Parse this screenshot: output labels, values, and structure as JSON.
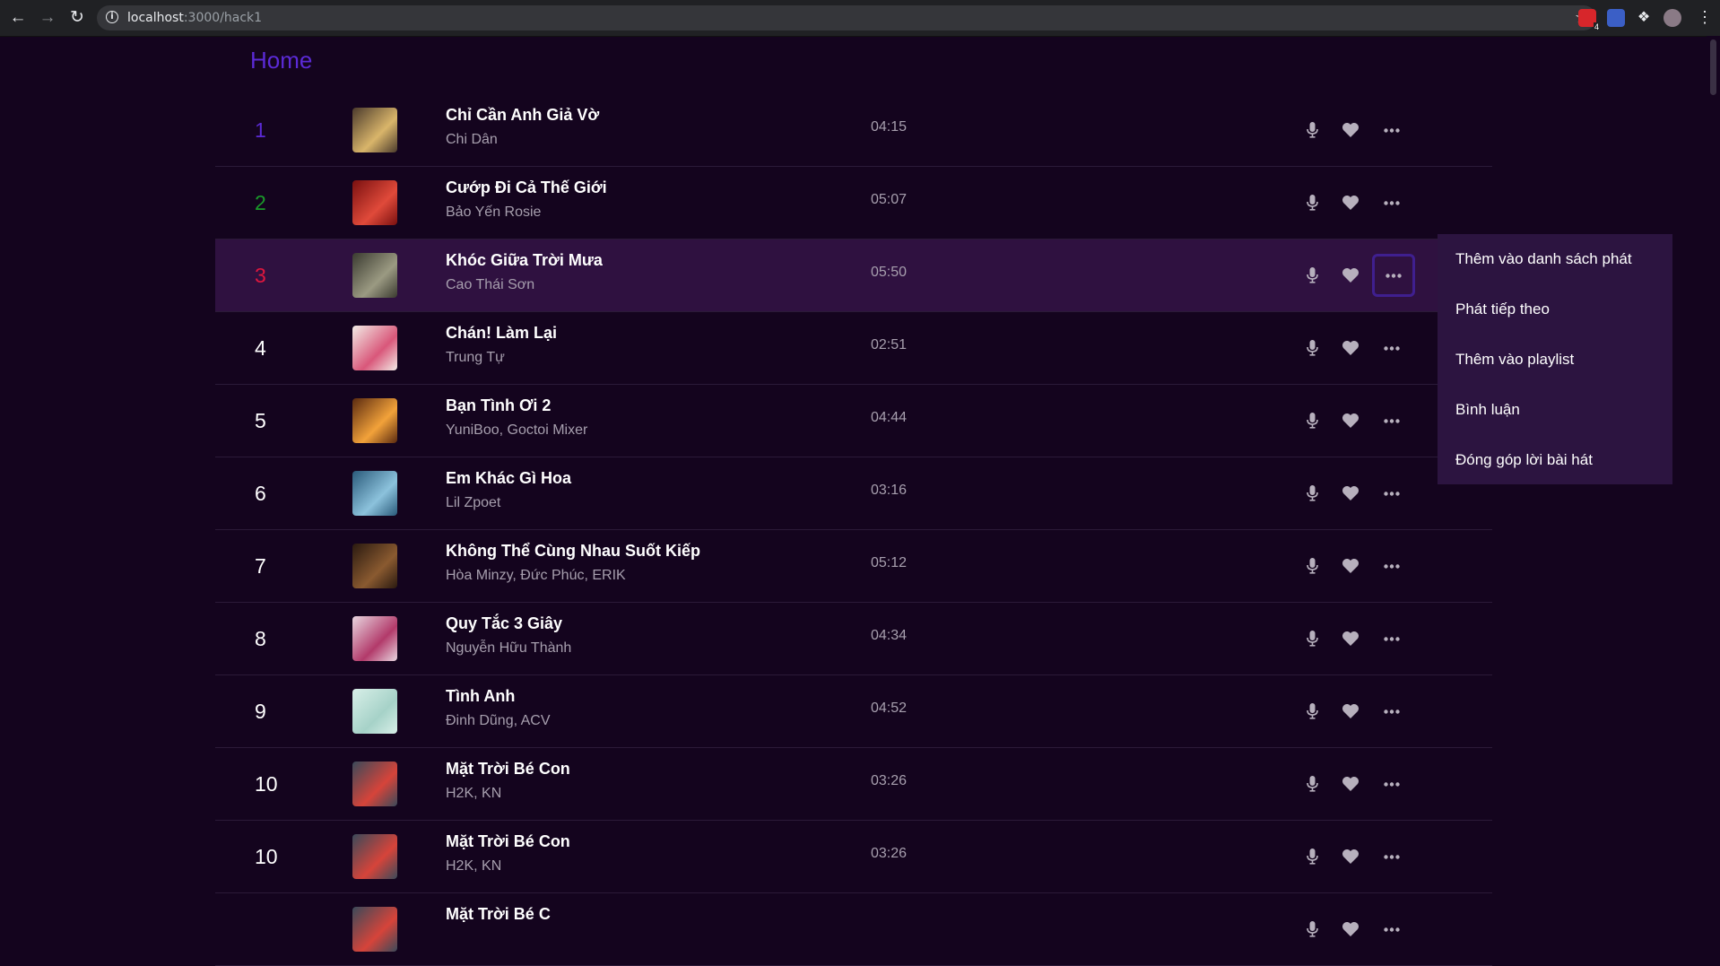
{
  "browser": {
    "url_host": "localhost",
    "url_path": ":3000/hack1",
    "ext_badge": "4"
  },
  "home_label": "Home",
  "colors": {
    "rank1": "#5b2ad6",
    "rank2": "#1a9a2a",
    "rank3": "#e0173e",
    "rank_default": "#ffffff",
    "active_row": "#2f1140",
    "dropdown_bg": "#2c1440"
  },
  "songs": [
    {
      "rank": "1",
      "title": "Chỉ Cần Anh Giả Vờ",
      "artist": "Chi Dân",
      "duration": "04:15",
      "thumb": [
        "#4a3a2c",
        "#d9b56a"
      ]
    },
    {
      "rank": "2",
      "title": "Cướp Đi Cả Thế Giới",
      "artist": "Bảo Yến Rosie",
      "duration": "05:07",
      "thumb": [
        "#7a1010",
        "#e04a3a"
      ]
    },
    {
      "rank": "3",
      "title": "Khóc Giữa Trời Mưa",
      "artist": "Cao Thái Sơn",
      "duration": "05:50",
      "thumb": [
        "#3a3a30",
        "#9b9a82"
      ]
    },
    {
      "rank": "4",
      "title": "Chán! Làm Lại",
      "artist": "Trung Tự",
      "duration": "02:51",
      "thumb": [
        "#f2ece6",
        "#d9577a"
      ]
    },
    {
      "rank": "5",
      "title": "Bạn Tình Ơi 2",
      "artist": "YuniBoo, Goctoi Mixer",
      "duration": "04:44",
      "thumb": [
        "#5a2a10",
        "#f2a23a"
      ]
    },
    {
      "rank": "6",
      "title": "Em Khác Gì Hoa",
      "artist": "Lil Zpoet",
      "duration": "03:16",
      "thumb": [
        "#2a5a7a",
        "#8cc2dc"
      ]
    },
    {
      "rank": "7",
      "title": "Không Thể Cùng Nhau Suốt Kiếp",
      "artist": "Hòa Minzy, Đức Phúc, ERIK",
      "duration": "05:12",
      "thumb": [
        "#2a1a10",
        "#8a5a30"
      ]
    },
    {
      "rank": "8",
      "title": "Quy Tắc 3 Giây",
      "artist": "Nguyễn Hữu Thành",
      "duration": "04:34",
      "thumb": [
        "#e8d6e0",
        "#b23a6a"
      ]
    },
    {
      "rank": "9",
      "title": "Tình Anh",
      "artist": "Đinh Dũng, ACV",
      "duration": "04:52",
      "thumb": [
        "#d8efe8",
        "#a6d2c8"
      ]
    },
    {
      "rank": "10",
      "title": "Mặt Trời Bé Con",
      "artist": "H2K, KN",
      "duration": "03:26",
      "thumb": [
        "#3a4a5a",
        "#d6443a"
      ]
    },
    {
      "rank": "10",
      "title": "Mặt Trời Bé Con",
      "artist": "H2K, KN",
      "duration": "03:26",
      "thumb": [
        "#3a4a5a",
        "#d6443a"
      ]
    },
    {
      "rank": "",
      "title": "Mặt Trời Bé C",
      "artist": "",
      "duration": "",
      "thumb": [
        "#3a4a5a",
        "#d6443a"
      ]
    }
  ],
  "active_index": 2,
  "dropdown": {
    "items": [
      "Thêm vào danh sách phát",
      "Phát tiếp theo",
      "Thêm vào playlist",
      "Bình luận",
      "Đóng góp lời bài hát"
    ]
  },
  "icons": {
    "mic": "microphone-icon",
    "heart": "heart-icon",
    "more": "more-dots-icon"
  }
}
